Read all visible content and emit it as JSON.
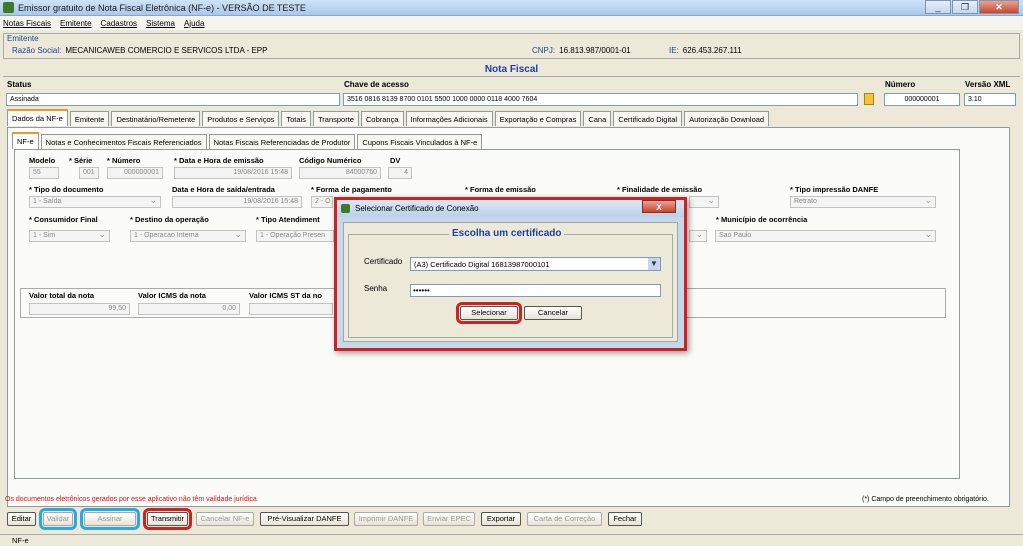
{
  "window": {
    "title": "Emissor gratuito de Nota Fiscal Eletrônica (NF-e) - VERSÃO DE TESTE"
  },
  "menu": [
    "Notas Fiscais",
    "Emitente",
    "Cadastros",
    "Sistema",
    "Ajuda"
  ],
  "emitente": {
    "legend": "Emitente",
    "razao_label": "Razão Social:",
    "razao_value": "MECANICAWEB COMERCIO E SERVICOS LTDA - EPP",
    "cnpj_label": "CNPJ:",
    "cnpj_value": "16.813.987/0001-01",
    "ie_label": "IE:",
    "ie_value": "626.453.267.111"
  },
  "nota": {
    "title": "Nota Fiscal",
    "status_label": "Status",
    "status_value": "Assinada",
    "chave_label": "Chave de acesso",
    "chave_value": "3516 0816 8139 8700 0101 5500 1000 0000 0118 4000 7604",
    "numero_label": "Número",
    "numero_value": "000000001",
    "versao_label": "Versão XML",
    "versao_value": "3.10"
  },
  "tabs": [
    "Dados da NF-e",
    "Emitente",
    "Destinatário/Remetente",
    "Produtos e Serviços",
    "Totais",
    "Transporte",
    "Cobrança",
    "Informações Adicionais",
    "Exportação e Compras",
    "Cana",
    "Certificado Digital",
    "Autorização Download"
  ],
  "subtabs": [
    "NF-e",
    "Notas e Conhecimentos Fiscais Referenciados",
    "Notas Fiscais Referenciadas de Produtor",
    "Cupons Fiscais Vinculados à NF-e"
  ],
  "fields": {
    "modelo_label": "Modelo",
    "modelo": "55",
    "serie_label": "* Série",
    "serie": "001",
    "numero_label": "* Número",
    "numero": "000000001",
    "data_emissao_label": "* Data e Hora de emissão",
    "data_emissao": "19/08/2016 15:48",
    "codigo_label": "Código Numérico",
    "codigo": "84000760",
    "dv_label": "DV",
    "dv": "4",
    "tipo_doc_label": "* Tipo do documento",
    "tipo_doc": "1 - Saída",
    "data_saida_label": "Data e Hora de saída/entrada",
    "data_saida": "19/08/2016 15:48",
    "forma_pag_label": "* Forma de pagamento",
    "forma_pag": "2 - O",
    "forma_emissao_label": "* Forma de emissão",
    "finalidade_label": "* Finalidade de emissão",
    "tipo_danfe_label": "* Tipo impressão DANFE",
    "tipo_danfe": "Retrato",
    "consumidor_label": "* Consumidor Final",
    "consumidor": "1 - Sim",
    "destino_label": "* Destino da operação",
    "destino": "1 - Operacao Interna",
    "tipo_atend_label": "* Tipo Atendiment",
    "tipo_atend": "1 - Operação Presen",
    "municipio_label": "* Município de ocorrência",
    "municipio": "Sao Paulo",
    "valor_total_label": "Valor total da nota",
    "valor_total": "99,50",
    "valor_icms_label": "Valor ICMS da nota",
    "valor_icms": "0,00",
    "valor_icms_st_label": "Valor ICMS ST da no"
  },
  "dialog": {
    "title": "Selecionar Certificado de Conexão",
    "close": "X",
    "legend": "Escolha um certificado",
    "cert_label": "Certificado",
    "cert_value": "(A3) Certificado Digital 16813987000101",
    "senha_label": "Senha",
    "senha_value": "••••••",
    "select_btn": "Selecionar",
    "cancel_btn": "Cancelar"
  },
  "footer": {
    "warning": "Os documentos eletrônicos gerados por esse aplicativo não têm validade jurídica",
    "required": "(*) Campo de preenchimento obrigatório.",
    "buttons": [
      "Editar",
      "Validar",
      "Assinar",
      "Transmitir",
      "Cancelar NF-e",
      "Pré-Visualizar DANFE",
      "Imprimir DANFE",
      "Enviar EPEC",
      "Exportar",
      "Carta de Correção",
      "Fechar"
    ]
  },
  "statusbar": "NF-e"
}
